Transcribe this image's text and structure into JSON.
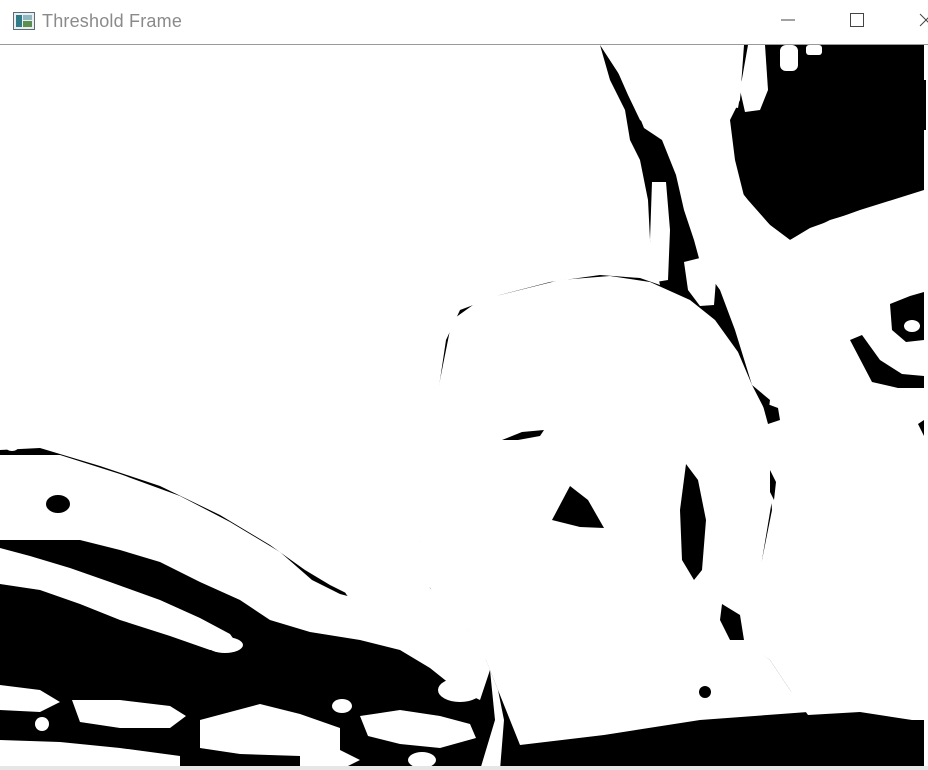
{
  "window": {
    "title": "Threshold Frame",
    "icons": {
      "app": "app-window-icon",
      "minimize": "minimize-icon",
      "maximize": "maximize-icon",
      "close": "close-icon"
    }
  },
  "image": {
    "description_name": "binary-threshold-image",
    "colors": {
      "foreground": "#ffffff",
      "background": "#000000"
    }
  },
  "colors": {
    "title_text": "#8a8a8a",
    "titlebar_bg": "#ffffff",
    "border": "#9a9a9a"
  }
}
